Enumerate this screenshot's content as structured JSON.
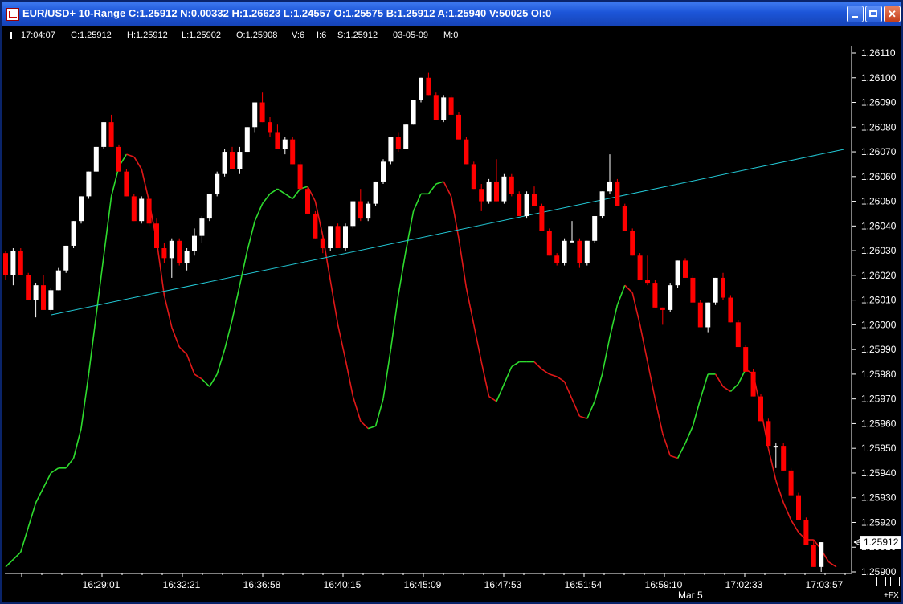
{
  "window": {
    "title": "EUR/USD+ 10-Range C:1.25912 N:0.00332 H:1.26623 L:1.24557 O:1.25575 B:1.25912 A:1.25940 V:50025 OI:0",
    "buttons": {
      "minimize": "minimize",
      "maximize": "maximize",
      "close": "close"
    }
  },
  "infobar": {
    "time": "17:04:07",
    "close": "C:1.25912",
    "high": "H:1.25912",
    "low": "L:1.25902",
    "open": "O:1.25908",
    "volume": "V:6",
    "index": "I:6",
    "spread": "S:1.25912",
    "date": "03-05-09",
    "mode": "M:0"
  },
  "footer": {
    "date_label": "Mar 5",
    "fx_label": "+FX"
  },
  "chart_data": {
    "type": "candlestick",
    "colors": {
      "up": "#FFFFFF",
      "down": "#FF0000",
      "trendline": "#22C7D4",
      "osc_up": "#2EDB2E",
      "osc_down": "#E01818",
      "background": "#000000"
    },
    "y_axis": {
      "range": [
        1.259,
        1.2611
      ],
      "ticks": [
        "1.26110",
        "1.26100",
        "1.26090",
        "1.26080",
        "1.26070",
        "1.26060",
        "1.26050",
        "1.26040",
        "1.26030",
        "1.26020",
        "1.26010",
        "1.26000",
        "1.25990",
        "1.25980",
        "1.25970",
        "1.25960",
        "1.25950",
        "1.25940",
        "1.25930",
        "1.25920",
        "1.25910",
        "1.25900"
      ],
      "current_price": "1.25912"
    },
    "x_axis": {
      "ticks": [
        "16:29:01",
        "16:32:21",
        "16:36:58",
        "16:40:15",
        "16:45:09",
        "16:47:53",
        "16:51:54",
        "16:59:10",
        "17:02:33",
        "17:03:57"
      ]
    },
    "candles": [
      [
        1.26029,
        1.2603,
        1.26018,
        1.2602
      ],
      [
        1.2602,
        1.26031,
        1.26016,
        1.2603
      ],
      [
        1.2603,
        1.26031,
        1.2602,
        1.2602
      ],
      [
        1.2602,
        1.26021,
        1.2601,
        1.2601
      ],
      [
        1.2601,
        1.26017,
        1.26003,
        1.26016
      ],
      [
        1.26016,
        1.2602,
        1.26006,
        1.26006
      ],
      [
        1.26006,
        1.26015,
        1.26005,
        1.26014
      ],
      [
        1.26014,
        1.26023,
        1.26014,
        1.26022
      ],
      [
        1.26022,
        1.26032,
        1.26021,
        1.26032
      ],
      [
        1.26032,
        1.26042,
        1.26031,
        1.26042
      ],
      [
        1.26042,
        1.26052,
        1.26041,
        1.26052
      ],
      [
        1.26052,
        1.26062,
        1.26051,
        1.26062
      ],
      [
        1.26062,
        1.26072,
        1.26062,
        1.26072
      ],
      [
        1.26072,
        1.26082,
        1.26071,
        1.26082
      ],
      [
        1.26082,
        1.26085,
        1.26072,
        1.26072
      ],
      [
        1.26072,
        1.26073,
        1.26062,
        1.26062
      ],
      [
        1.26062,
        1.26063,
        1.26052,
        1.26052
      ],
      [
        1.26052,
        1.26053,
        1.26042,
        1.26042
      ],
      [
        1.26042,
        1.26052,
        1.26041,
        1.26051
      ],
      [
        1.26051,
        1.26052,
        1.2604,
        1.26041
      ],
      [
        1.26041,
        1.26043,
        1.26031,
        1.26031
      ],
      [
        1.26031,
        1.26033,
        1.26025,
        1.26027
      ],
      [
        1.26027,
        1.26035,
        1.26019,
        1.26034
      ],
      [
        1.26034,
        1.26035,
        1.26024,
        1.26025
      ],
      [
        1.26025,
        1.26031,
        1.26022,
        1.2603
      ],
      [
        1.2603,
        1.26039,
        1.26028,
        1.26036
      ],
      [
        1.26036,
        1.26044,
        1.26033,
        1.26043
      ],
      [
        1.26043,
        1.26053,
        1.26042,
        1.26053
      ],
      [
        1.26053,
        1.26062,
        1.26052,
        1.26061
      ],
      [
        1.26061,
        1.26071,
        1.2606,
        1.2607
      ],
      [
        1.2607,
        1.26072,
        1.26063,
        1.26063
      ],
      [
        1.26063,
        1.26072,
        1.26061,
        1.2607
      ],
      [
        1.2607,
        1.2608,
        1.2607,
        1.2608
      ],
      [
        1.2608,
        1.2609,
        1.26078,
        1.2609
      ],
      [
        1.2609,
        1.26094,
        1.26082,
        1.26082
      ],
      [
        1.26082,
        1.26084,
        1.26076,
        1.26078
      ],
      [
        1.26078,
        1.26081,
        1.26071,
        1.26071
      ],
      [
        1.26071,
        1.26076,
        1.26069,
        1.26075
      ],
      [
        1.26075,
        1.26076,
        1.26065,
        1.26065
      ],
      [
        1.26065,
        1.26066,
        1.26054,
        1.26055
      ],
      [
        1.26055,
        1.26056,
        1.26045,
        1.26045
      ],
      [
        1.26045,
        1.26046,
        1.26035,
        1.26035
      ],
      [
        1.26035,
        1.26036,
        1.26029,
        1.26031
      ],
      [
        1.26031,
        1.2604,
        1.2603,
        1.2604
      ],
      [
        1.2604,
        1.26041,
        1.26031,
        1.26031
      ],
      [
        1.26031,
        1.26041,
        1.2603,
        1.2604
      ],
      [
        1.2604,
        1.2605,
        1.26039,
        1.2605
      ],
      [
        1.2605,
        1.26055,
        1.26042,
        1.26043
      ],
      [
        1.26043,
        1.2605,
        1.26042,
        1.26049
      ],
      [
        1.26049,
        1.26058,
        1.26048,
        1.26058
      ],
      [
        1.26058,
        1.26067,
        1.26057,
        1.26066
      ],
      [
        1.26066,
        1.26076,
        1.26065,
        1.26076
      ],
      [
        1.26076,
        1.26078,
        1.2607,
        1.26071
      ],
      [
        1.26071,
        1.26081,
        1.26071,
        1.26081
      ],
      [
        1.26081,
        1.26091,
        1.26081,
        1.26091
      ],
      [
        1.26091,
        1.261,
        1.2609,
        1.261
      ],
      [
        1.261,
        1.26102,
        1.26093,
        1.26093
      ],
      [
        1.26093,
        1.26094,
        1.26083,
        1.26083
      ],
      [
        1.26083,
        1.26093,
        1.26082,
        1.26092
      ],
      [
        1.26092,
        1.26093,
        1.26085,
        1.26085
      ],
      [
        1.26085,
        1.26086,
        1.26075,
        1.26075
      ],
      [
        1.26075,
        1.26076,
        1.26065,
        1.26065
      ],
      [
        1.26065,
        1.26066,
        1.26055,
        1.26055
      ],
      [
        1.26055,
        1.26057,
        1.26046,
        1.2605
      ],
      [
        1.2605,
        1.26059,
        1.26049,
        1.26058
      ],
      [
        1.26058,
        1.26067,
        1.2605,
        1.2605
      ],
      [
        1.2605,
        1.26061,
        1.26049,
        1.2606
      ],
      [
        1.2606,
        1.26061,
        1.26052,
        1.26053
      ],
      [
        1.26053,
        1.26054,
        1.26044,
        1.26044
      ],
      [
        1.26044,
        1.26054,
        1.26043,
        1.26053
      ],
      [
        1.26053,
        1.26056,
        1.26048,
        1.26048
      ],
      [
        1.26048,
        1.26049,
        1.26038,
        1.26038
      ],
      [
        1.26038,
        1.26039,
        1.26028,
        1.26028
      ],
      [
        1.26028,
        1.26029,
        1.26024,
        1.26025
      ],
      [
        1.26025,
        1.26035,
        1.26024,
        1.26034
      ],
      [
        1.26034,
        1.26042,
        1.26034,
        1.26034
      ],
      [
        1.26034,
        1.26035,
        1.26023,
        1.26025
      ],
      [
        1.26025,
        1.26034,
        1.26024,
        1.26034
      ],
      [
        1.26034,
        1.26044,
        1.26033,
        1.26044
      ],
      [
        1.26044,
        1.26054,
        1.26043,
        1.26054
      ],
      [
        1.26054,
        1.26069,
        1.26053,
        1.26058
      ],
      [
        1.26058,
        1.26059,
        1.26048,
        1.26048
      ],
      [
        1.26048,
        1.26049,
        1.26038,
        1.26038
      ],
      [
        1.26038,
        1.26039,
        1.26028,
        1.26028
      ],
      [
        1.26028,
        1.26029,
        1.26018,
        1.26018
      ],
      [
        1.26018,
        1.26028,
        1.26016,
        1.26017
      ],
      [
        1.26017,
        1.26018,
        1.26007,
        1.26007
      ],
      [
        1.26007,
        1.26007,
        1.26,
        1.26006
      ],
      [
        1.26006,
        1.26017,
        1.26005,
        1.26016
      ],
      [
        1.26016,
        1.26026,
        1.26015,
        1.26026
      ],
      [
        1.26026,
        1.26027,
        1.26019,
        1.26019
      ],
      [
        1.26019,
        1.2602,
        1.26009,
        1.26009
      ],
      [
        1.26009,
        1.2601,
        1.25999,
        1.25999
      ],
      [
        1.25999,
        1.26009,
        1.25997,
        1.26009
      ],
      [
        1.26009,
        1.26019,
        1.26008,
        1.26019
      ],
      [
        1.26019,
        1.26021,
        1.2601,
        1.26011
      ],
      [
        1.26011,
        1.26012,
        1.26001,
        1.26001
      ],
      [
        1.26001,
        1.26002,
        1.25991,
        1.25991
      ],
      [
        1.25991,
        1.25992,
        1.25981,
        1.25981
      ],
      [
        1.25981,
        1.25982,
        1.25971,
        1.25971
      ],
      [
        1.25971,
        1.25972,
        1.25961,
        1.25961
      ],
      [
        1.25961,
        1.25962,
        1.25951,
        1.25951
      ],
      [
        1.25951,
        1.25952,
        1.25942,
        1.25951
      ],
      [
        1.25951,
        1.25952,
        1.25941,
        1.25941
      ],
      [
        1.25941,
        1.25942,
        1.25931,
        1.25931
      ],
      [
        1.25931,
        1.25932,
        1.25921,
        1.25921
      ],
      [
        1.25921,
        1.25922,
        1.25911,
        1.25911
      ],
      [
        1.25911,
        1.25913,
        1.25902,
        1.25902
      ],
      [
        1.25902,
        1.25912,
        1.259,
        1.25912
      ]
    ],
    "trendline": {
      "from_index": 6,
      "from_price": 1.26004,
      "to_index": 111,
      "to_price": 1.26071
    },
    "oscillator": {
      "values": [
        1.25902,
        1.25905,
        1.25908,
        1.25918,
        1.25928,
        1.25934,
        1.2594,
        1.25942,
        1.25942,
        1.25946,
        1.25958,
        1.2598,
        1.26004,
        1.26028,
        1.26052,
        1.26064,
        1.26069,
        1.26068,
        1.26063,
        1.2605,
        1.26034,
        1.26012,
        1.25999,
        1.25991,
        1.25988,
        1.2598,
        1.25978,
        1.25975,
        1.2598,
        1.2599,
        1.26002,
        1.26016,
        1.2603,
        1.26042,
        1.26049,
        1.26053,
        1.26055,
        1.26053,
        1.26051,
        1.26055,
        1.26056,
        1.2605,
        1.26036,
        1.26018,
        1.26,
        1.25986,
        1.25971,
        1.25961,
        1.25958,
        1.25959,
        1.2597,
        1.2599,
        1.26012,
        1.2603,
        1.26046,
        1.26053,
        1.26053,
        1.26057,
        1.26058,
        1.26052,
        1.26035,
        1.26015,
        1.26,
        1.25985,
        1.25971,
        1.25969,
        1.25976,
        1.25983,
        1.25985,
        1.25985,
        1.25985,
        1.25982,
        1.2598,
        1.25979,
        1.25977,
        1.2597,
        1.25963,
        1.25962,
        1.25969,
        1.2598,
        1.25995,
        1.26008,
        1.26016,
        1.26013,
        1.26,
        1.25985,
        1.2597,
        1.25956,
        1.25947,
        1.25946,
        1.25952,
        1.25959,
        1.2597,
        1.2598,
        1.2598,
        1.25975,
        1.25973,
        1.25976,
        1.25982,
        1.2598,
        1.25966,
        1.2595,
        1.25937,
        1.25928,
        1.25921,
        1.25916,
        1.25913,
        1.25913,
        1.25909,
        1.25904,
        1.25902
      ],
      "signal": [
        0,
        1,
        1,
        1,
        1,
        1,
        1,
        1,
        1,
        1,
        1,
        1,
        1,
        1,
        1,
        1,
        1,
        0,
        0,
        0,
        0,
        0,
        0,
        0,
        0,
        0,
        0,
        1,
        1,
        1,
        1,
        1,
        1,
        1,
        1,
        1,
        1,
        1,
        1,
        1,
        1,
        0,
        0,
        0,
        0,
        0,
        0,
        0,
        0,
        1,
        1,
        1,
        1,
        1,
        1,
        1,
        1,
        1,
        1,
        0,
        0,
        0,
        0,
        0,
        0,
        0,
        1,
        1,
        1,
        1,
        1,
        0,
        0,
        0,
        0,
        0,
        0,
        0,
        1,
        1,
        1,
        1,
        1,
        0,
        0,
        0,
        0,
        0,
        0,
        0,
        1,
        1,
        1,
        1,
        1,
        0,
        0,
        1,
        1,
        0,
        0,
        0,
        0,
        0,
        0,
        0,
        0,
        0,
        0,
        0,
        0
      ]
    }
  }
}
